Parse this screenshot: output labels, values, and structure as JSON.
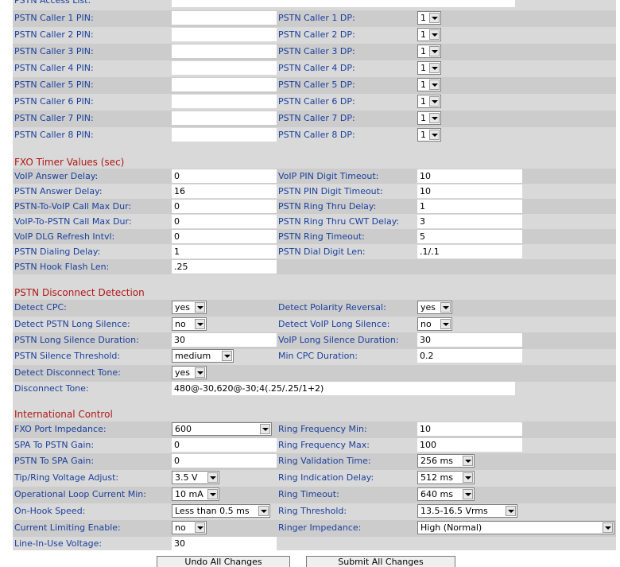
{
  "pstn_access_list": {
    "label": "PSTN Access List:",
    "value": ""
  },
  "pstn_callers": [
    {
      "pin_label": "PSTN Caller 1 PIN:",
      "pin_value": "",
      "dp_label": "PSTN Caller 1 DP:",
      "dp_value": "1"
    },
    {
      "pin_label": "PSTN Caller 2 PIN:",
      "pin_value": "",
      "dp_label": "PSTN Caller 2 DP:",
      "dp_value": "1"
    },
    {
      "pin_label": "PSTN Caller 3 PIN:",
      "pin_value": "",
      "dp_label": "PSTN Caller 3 DP:",
      "dp_value": "1"
    },
    {
      "pin_label": "PSTN Caller 4 PIN:",
      "pin_value": "",
      "dp_label": "PSTN Caller 4 DP:",
      "dp_value": "1"
    },
    {
      "pin_label": "PSTN Caller 5 PIN:",
      "pin_value": "",
      "dp_label": "PSTN Caller 5 DP:",
      "dp_value": "1"
    },
    {
      "pin_label": "PSTN Caller 6 PIN:",
      "pin_value": "",
      "dp_label": "PSTN Caller 6 DP:",
      "dp_value": "1"
    },
    {
      "pin_label": "PSTN Caller 7 PIN:",
      "pin_value": "",
      "dp_label": "PSTN Caller 7 DP:",
      "dp_value": "1"
    },
    {
      "pin_label": "PSTN Caller 8 PIN:",
      "pin_value": "",
      "dp_label": "PSTN Caller 8 DP:",
      "dp_value": "1"
    }
  ],
  "fxo_timer": {
    "title": "FXO Timer Values (sec)",
    "rows": [
      {
        "left_label": "VoIP Answer Delay:",
        "left_value": "0",
        "right_label": "VoIP PIN Digit Timeout:",
        "right_value": "10"
      },
      {
        "left_label": "PSTN Answer Delay:",
        "left_value": "16",
        "right_label": "PSTN PIN Digit Timeout:",
        "right_value": "10"
      },
      {
        "left_label": "PSTN-To-VoIP Call Max Dur:",
        "left_value": "0",
        "right_label": "PSTN Ring Thru Delay:",
        "right_value": "1"
      },
      {
        "left_label": "VoIP-To-PSTN Call Max Dur:",
        "left_value": "0",
        "right_label": "PSTN Ring Thru CWT Delay:",
        "right_value": "3"
      },
      {
        "left_label": "VoIP DLG Refresh Intvl:",
        "left_value": "0",
        "right_label": "PSTN Ring Timeout:",
        "right_value": "5"
      },
      {
        "left_label": "PSTN Dialing Delay:",
        "left_value": "1",
        "right_label": "PSTN Dial Digit Len:",
        "right_value": ".1/.1"
      },
      {
        "left_label": "PSTN Hook Flash Len:",
        "left_value": ".25"
      }
    ]
  },
  "disconnect": {
    "title": "PSTN Disconnect Detection",
    "detect_cpc": {
      "label": "Detect CPC:",
      "value": "yes"
    },
    "detect_polarity": {
      "label": "Detect Polarity Reversal:",
      "value": "yes"
    },
    "detect_pstn_long_silence": {
      "label": "Detect PSTN Long Silence:",
      "value": "no"
    },
    "detect_voip_long_silence": {
      "label": "Detect VoIP Long Silence:",
      "value": "no"
    },
    "pstn_long_silence_duration": {
      "label": "PSTN Long Silence Duration:",
      "value": "30"
    },
    "voip_long_silence_duration": {
      "label": "VoIP Long Silence Duration:",
      "value": "30"
    },
    "pstn_silence_threshold": {
      "label": "PSTN Silence Threshold:",
      "value": "medium"
    },
    "min_cpc_duration": {
      "label": "Min CPC Duration:",
      "value": "0.2"
    },
    "detect_disconnect_tone": {
      "label": "Detect Disconnect Tone:",
      "value": "yes"
    },
    "disconnect_tone": {
      "label": "Disconnect Tone:",
      "value": "480@-30,620@-30;4(.25/.25/1+2)"
    }
  },
  "intl": {
    "title": "International Control",
    "fxo_port_impedance": {
      "label": "FXO Port Impedance:",
      "value": "600"
    },
    "ring_freq_min": {
      "label": "Ring Frequency Min:",
      "value": "10"
    },
    "spa_to_pstn_gain": {
      "label": "SPA To PSTN Gain:",
      "value": "0"
    },
    "ring_freq_max": {
      "label": "Ring Frequency Max:",
      "value": "100"
    },
    "pstn_to_spa_gain": {
      "label": "PSTN To SPA Gain:",
      "value": "0"
    },
    "ring_validation_time": {
      "label": "Ring Validation Time:",
      "value": "256 ms"
    },
    "tip_ring_voltage": {
      "label": "Tip/Ring Voltage Adjust:",
      "value": "3.5 V"
    },
    "ring_indication_delay": {
      "label": "Ring Indication Delay:",
      "value": "512 ms"
    },
    "op_loop_current": {
      "label": "Operational Loop Current Min:",
      "value": "10 mA"
    },
    "ring_timeout": {
      "label": "Ring Timeout:",
      "value": "640 ms"
    },
    "on_hook_speed": {
      "label": "On-Hook Speed:",
      "value": "Less than 0.5 ms"
    },
    "ring_threshold": {
      "label": "Ring Threshold:",
      "value": "13.5-16.5 Vrms"
    },
    "current_limiting": {
      "label": "Current Limiting Enable:",
      "value": "no"
    },
    "ringer_impedance": {
      "label": "Ringer Impedance:",
      "value": "High (Normal)"
    },
    "line_in_use_voltage": {
      "label": "Line-In-Use Voltage:",
      "value": "30"
    }
  },
  "footer": {
    "undo_label": "Undo All Changes",
    "submit_label": "Submit All Changes"
  }
}
